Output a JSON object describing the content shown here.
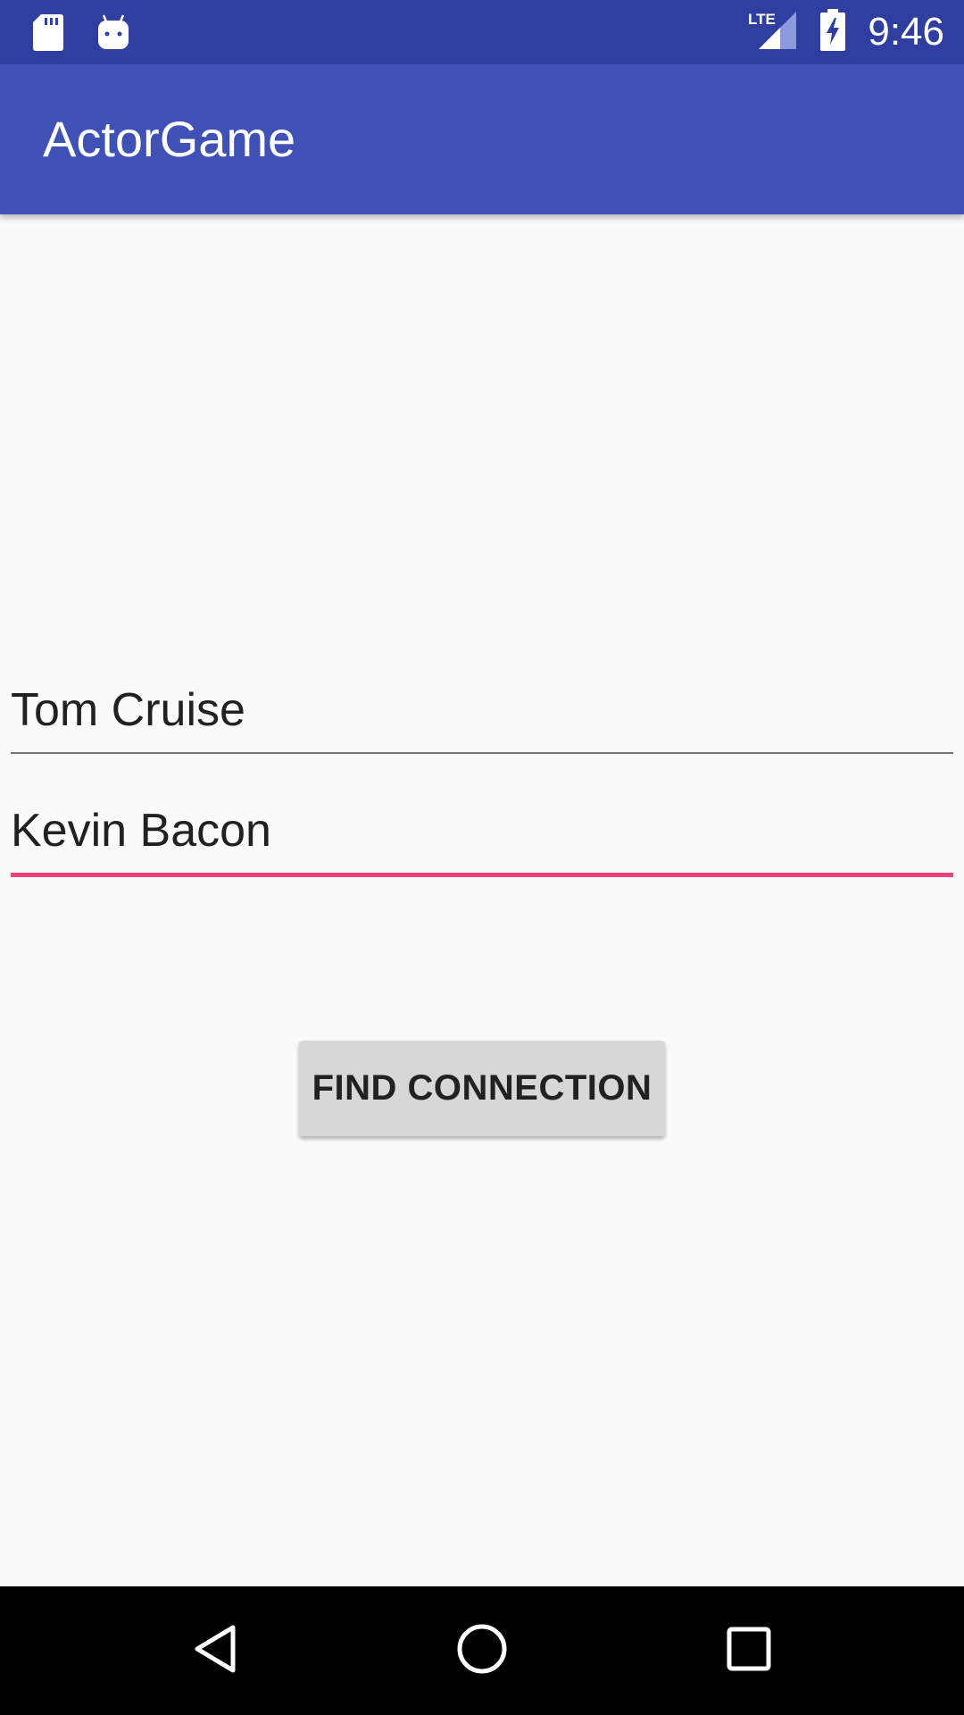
{
  "status_bar": {
    "time": "9:46",
    "left_icons": [
      "sd-card-icon",
      "android-icon"
    ],
    "right_icons": [
      "lte-signal-icon",
      "battery-charging-icon"
    ],
    "lte_label": "LTE"
  },
  "app_bar": {
    "title": "ActorGame"
  },
  "form": {
    "actor_one": {
      "value": "Tom Cruise",
      "focused": false
    },
    "actor_two": {
      "value": "Kevin Bacon",
      "focused": true
    },
    "find_button_label": "FIND CONNECTION"
  },
  "nav_bar": {
    "buttons": [
      "back-icon",
      "home-icon",
      "recents-icon"
    ]
  },
  "colors": {
    "status_bar": "#303f9f",
    "app_bar": "#3f51b5",
    "accent": "#ec407a",
    "background": "#fafafa",
    "button": "#d6d7d7"
  }
}
